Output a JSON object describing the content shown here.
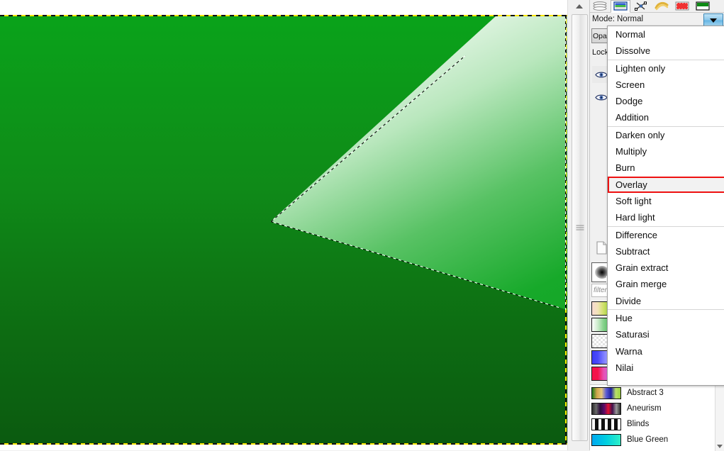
{
  "window": {
    "app": "GIMP"
  },
  "dock": {
    "tabs": [
      {
        "name": "layers-tab",
        "icon": "layers-icon",
        "selected": true
      },
      {
        "name": "channels-tab",
        "icon": "channels-icon",
        "selected": false
      },
      {
        "name": "paths-tab",
        "icon": "paths-icon",
        "selected": false
      },
      {
        "name": "undo-history-tab",
        "icon": "undo-history-icon",
        "selected": false
      },
      {
        "name": "colormap-tab",
        "icon": "colormap-icon",
        "selected": false
      },
      {
        "name": "gradients-tab",
        "icon": "gradients-icon",
        "selected": false
      }
    ],
    "mode_label": "Mode:",
    "mode_value": "Normal",
    "opacity_label": "Opasi",
    "lock_label": "Lock:",
    "filter_placeholder": "filter"
  },
  "mode_menu": {
    "highlighted": "Overlay",
    "highlight_color": "#ee1111",
    "items": [
      {
        "label": "Normal",
        "separator_above": false
      },
      {
        "label": "Dissolve",
        "separator_above": false
      },
      {
        "label": "Lighten only",
        "separator_above": true
      },
      {
        "label": "Screen",
        "separator_above": false
      },
      {
        "label": "Dodge",
        "separator_above": false
      },
      {
        "label": "Addition",
        "separator_above": false
      },
      {
        "label": "Darken only",
        "separator_above": true
      },
      {
        "label": "Multiply",
        "separator_above": false
      },
      {
        "label": "Burn",
        "separator_above": false
      },
      {
        "label": "Overlay",
        "separator_above": false
      },
      {
        "label": "Soft light",
        "separator_above": false
      },
      {
        "label": "Hard light",
        "separator_above": false
      },
      {
        "label": "Difference",
        "separator_above": true
      },
      {
        "label": "Subtract",
        "separator_above": false
      },
      {
        "label": "Grain extract",
        "separator_above": false
      },
      {
        "label": "Grain merge",
        "separator_above": false
      },
      {
        "label": "Divide",
        "separator_above": false
      },
      {
        "label": "Hue",
        "separator_above": true
      },
      {
        "label": "Saturasi",
        "separator_above": false
      },
      {
        "label": "Warna",
        "separator_above": false
      },
      {
        "label": "Nilai",
        "separator_above": false
      }
    ]
  },
  "gradient_swatches_behind": [
    {
      "name": "swatch-pastel",
      "css": "linear-gradient(to right,#f7d9d2,#f2e3b8,#cfe06a,#9fd13f)"
    },
    {
      "name": "swatch-green",
      "css": "linear-gradient(to right,#ffffff,#cdeccd,#86d28c,#5cc067)"
    },
    {
      "name": "swatch-checker",
      "css": "repeating-conic-gradient(#e2e2e2 0% 25%, #ffffff 0% 50%) 0 0/6px 6px"
    },
    {
      "name": "swatch-blue",
      "css": "linear-gradient(to right,#3b3bf5,#4a4afa,#7c7cff,#a9a9ff)"
    },
    {
      "name": "swatch-pink",
      "css": "linear-gradient(to right,#f4124a,#f4124a,#e84fb0,#d06ce0)"
    }
  ],
  "gradient_list": {
    "items": [
      {
        "label": "Abstract 3",
        "swatch": "linear-gradient(to right,#1b7a1b,#cfa34a,#e6c77a,#5b5bd6,#2020a0,#b9e06a,#9bd23f)"
      },
      {
        "label": "Aneurism",
        "swatch": "linear-gradient(to right,#2a2a2a,#6a6a6a,#2b0a3a,#5a0a6a,#e01030,#40104a,#9a9a9a,#2a2a2a)"
      },
      {
        "label": "Blinds",
        "swatch": "repeating-linear-gradient(to right,#ffffff 0 4px,#101010 4px 9px)"
      },
      {
        "label": "Blue Green",
        "swatch": "linear-gradient(to right,#00a8f0,#00cfe0,#2ff0c8)"
      }
    ]
  },
  "canvas": {
    "background_gradient": "green vertical gradient",
    "wedge_gradient": "white to green linear gradient",
    "selection": "triangular marching-ants selection",
    "layer_boundary": "yellow black dashed"
  },
  "scrollbar": {
    "up_arrow": "scroll-up-arrow",
    "down_arrow": "scroll-down-arrow"
  }
}
